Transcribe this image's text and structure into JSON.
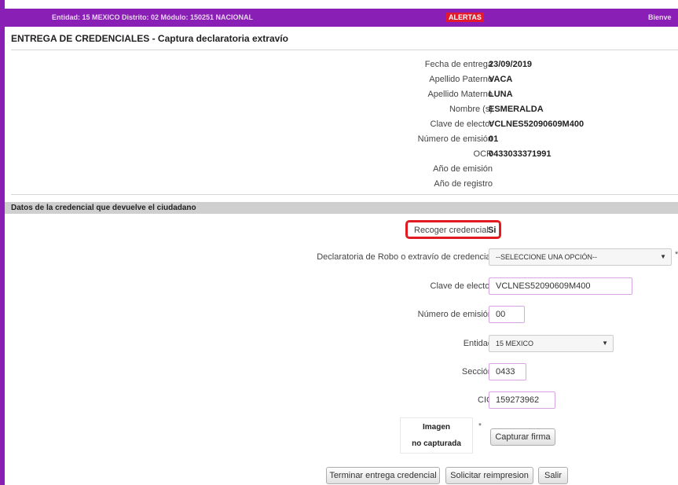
{
  "header": {
    "context": "Entidad: 15 MEXICO Distrito: 02 Módulo: 150251 NACIONAL",
    "alerts_label": "ALERTAS",
    "welcome": "Bienve"
  },
  "page_title": "ENTREGA DE CREDENCIALES - Captura declaratoria extravío",
  "citizen_info": [
    {
      "label": "Fecha de entrega",
      "value": "23/09/2019"
    },
    {
      "label": "Apellido Paterno",
      "value": "VACA"
    },
    {
      "label": "Apellido Materno",
      "value": "LUNA"
    },
    {
      "label": "Nombre (s)",
      "value": "ESMERALDA"
    },
    {
      "label": "Clave de elector",
      "value": "VCLNES52090609M400"
    },
    {
      "label": "Número de emisión",
      "value": "01"
    },
    {
      "label": "OCR",
      "value": "0433033371991"
    },
    {
      "label": "Año de emisión",
      "value": ""
    },
    {
      "label": "Año de registro",
      "value": ""
    }
  ],
  "section_title": "Datos de la credencial que devuelve el ciudadano",
  "form": {
    "recoger": {
      "label": "Recoger credencial",
      "value": "Si"
    },
    "declaratoria": {
      "label": "Declaratoria de Robo o extravío de credencial",
      "selected": "--SELECCIONE UNA OPCIÓN--",
      "required_mark": "*"
    },
    "clave_elector": {
      "label": "Clave de elector",
      "value": "VCLNES52090609M400"
    },
    "numero_emision": {
      "label": "Número de emisión",
      "value": "00"
    },
    "entidad": {
      "label": "Entidad",
      "selected": "15 MEXICO"
    },
    "seccion": {
      "label": "Sección",
      "value": "0433"
    },
    "cic": {
      "label": "CIC",
      "value": "159273962"
    },
    "signature": {
      "line1": "Imagen",
      "line2": "no capturada",
      "required_mark": "*",
      "capture_button": "Capturar firma"
    }
  },
  "actions": {
    "finish": "Terminar entrega credencial",
    "reprint": "Solicitar reimpresion",
    "exit": "Salir"
  },
  "colors": {
    "brand": "#8a1fb5",
    "alert": "#e4192c",
    "highlight": "#e11b22",
    "field_border": "#d9a6e4"
  }
}
